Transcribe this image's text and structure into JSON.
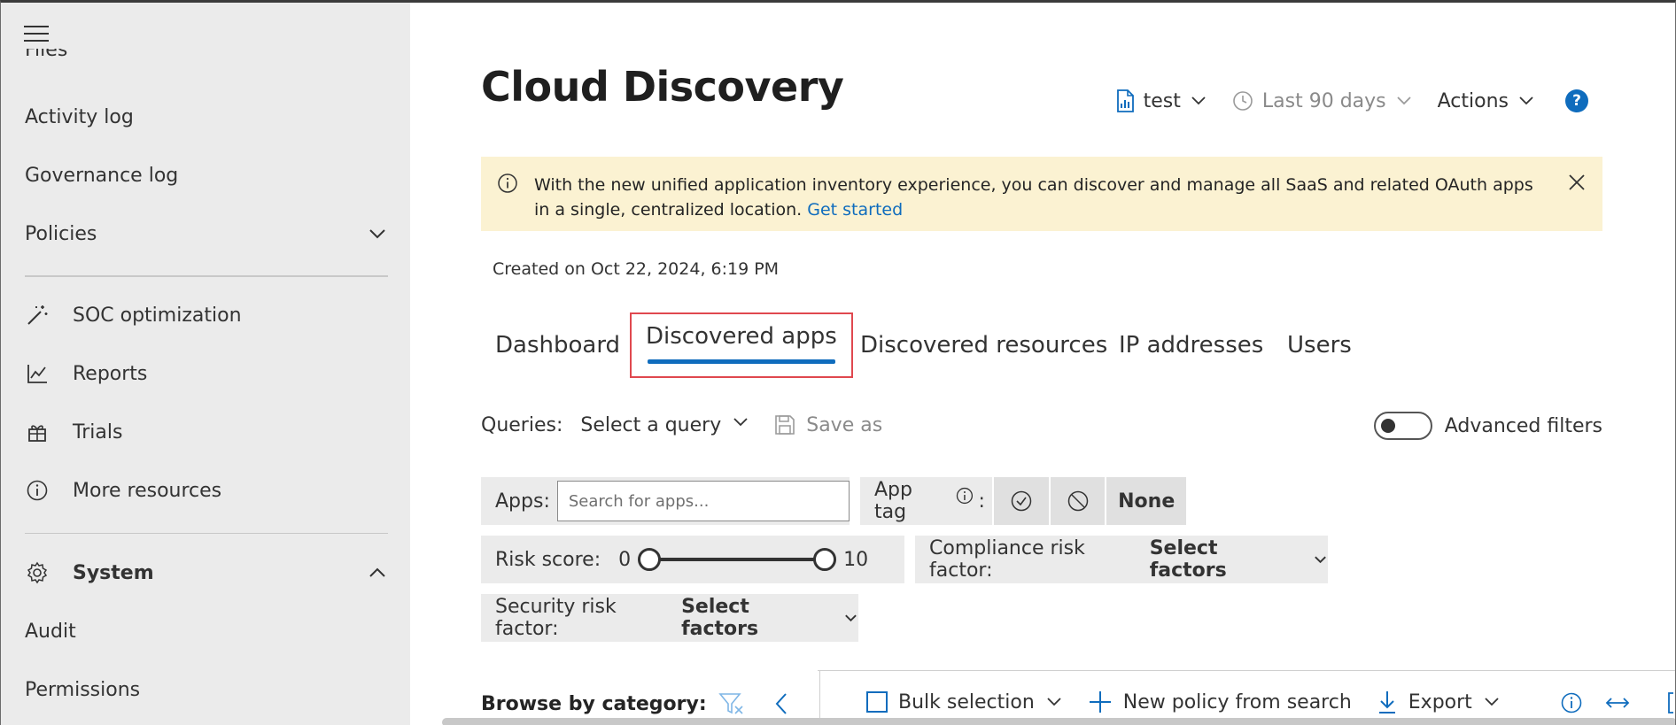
{
  "sidebar": {
    "clipped_item": "Files",
    "items": [
      {
        "label": "Activity log"
      },
      {
        "label": "Governance log"
      },
      {
        "label": "Policies"
      },
      {
        "label": "SOC optimization",
        "icon": "wand-icon"
      },
      {
        "label": "Reports",
        "icon": "chart-line-icon"
      },
      {
        "label": "Trials",
        "icon": "trials-icon"
      },
      {
        "label": "More resources",
        "icon": "info-icon"
      },
      {
        "label": "System",
        "icon": "gear-icon"
      },
      {
        "label": "Audit"
      },
      {
        "label": "Permissions"
      }
    ]
  },
  "header": {
    "title": "Cloud Discovery",
    "report_label": "test",
    "period_label": "Last 90 days",
    "actions_label": "Actions",
    "help_label": "?"
  },
  "banner": {
    "text": "With the new unified application inventory experience, you can discover and manage all SaaS and related OAuth apps in a single, centralized location.",
    "link": "Get started"
  },
  "created_on": "Created on Oct 22, 2024, 6:19 PM",
  "tabs": [
    {
      "label": "Dashboard"
    },
    {
      "label": "Discovered apps",
      "active": true
    },
    {
      "label": "Discovered resources"
    },
    {
      "label": "IP addresses"
    },
    {
      "label": "Users"
    }
  ],
  "queries": {
    "label": "Queries:",
    "select_label": "Select a query",
    "save_as_label": "Save as"
  },
  "advanced_filters": {
    "label": "Advanced filters",
    "enabled": false
  },
  "filters": {
    "apps_label": "Apps:",
    "apps_placeholder": "Search for apps...",
    "app_tag_label": "App tag",
    "app_tag_colon": ":",
    "none_label": "None",
    "risk_label": "Risk score:",
    "risk_min": "0",
    "risk_max": "10",
    "risk_range": [
      0,
      10
    ],
    "compliance_label": "Compliance risk factor:",
    "compliance_value": "Select factors",
    "security_label": "Security risk factor:",
    "security_value": "Select factors"
  },
  "bottom": {
    "browse_label": "Browse by category:",
    "bulk_label": "Bulk selection",
    "new_policy_label": "New policy from search",
    "export_label": "Export"
  },
  "colors": {
    "accent": "#0f6cbd",
    "banner_bg": "#fbf2d2",
    "sidebar_bg": "#ebebeb",
    "highlight_border": "#e0484f"
  }
}
